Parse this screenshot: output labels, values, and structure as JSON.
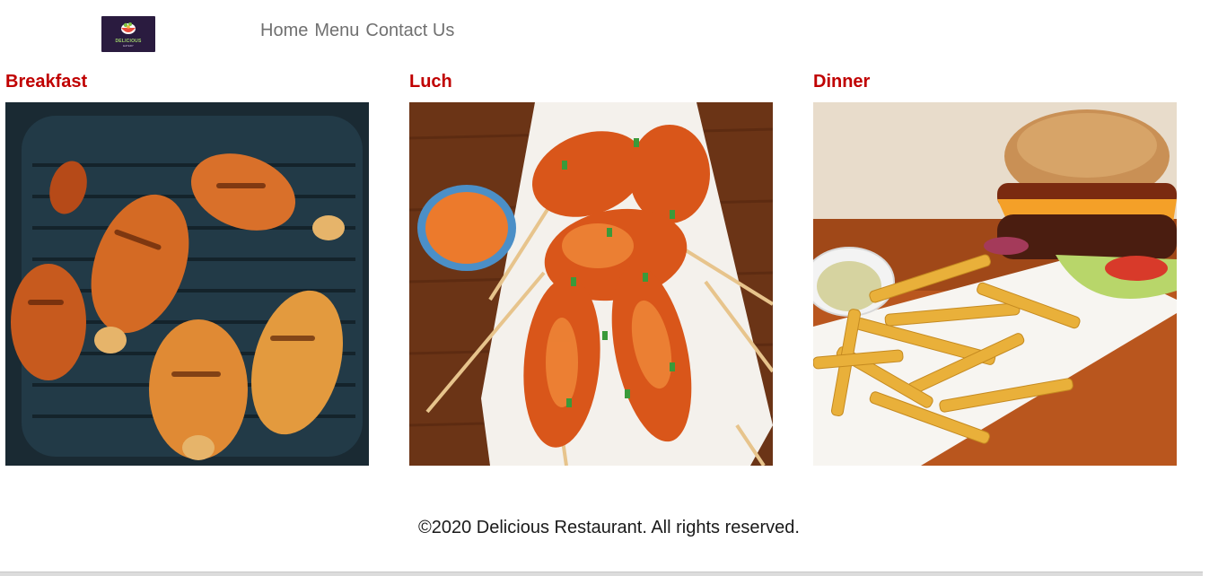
{
  "logo": {
    "text": "DELICIOUS",
    "sub": "EATERY"
  },
  "nav": {
    "home": "Home",
    "menu": "Menu",
    "contact": "Contact Us"
  },
  "sections": [
    {
      "title": "Breakfast"
    },
    {
      "title": "Luch"
    },
    {
      "title": "Dinner"
    }
  ],
  "footer": {
    "text": "©2020 Delicious Restaurant. All rights reserved."
  }
}
